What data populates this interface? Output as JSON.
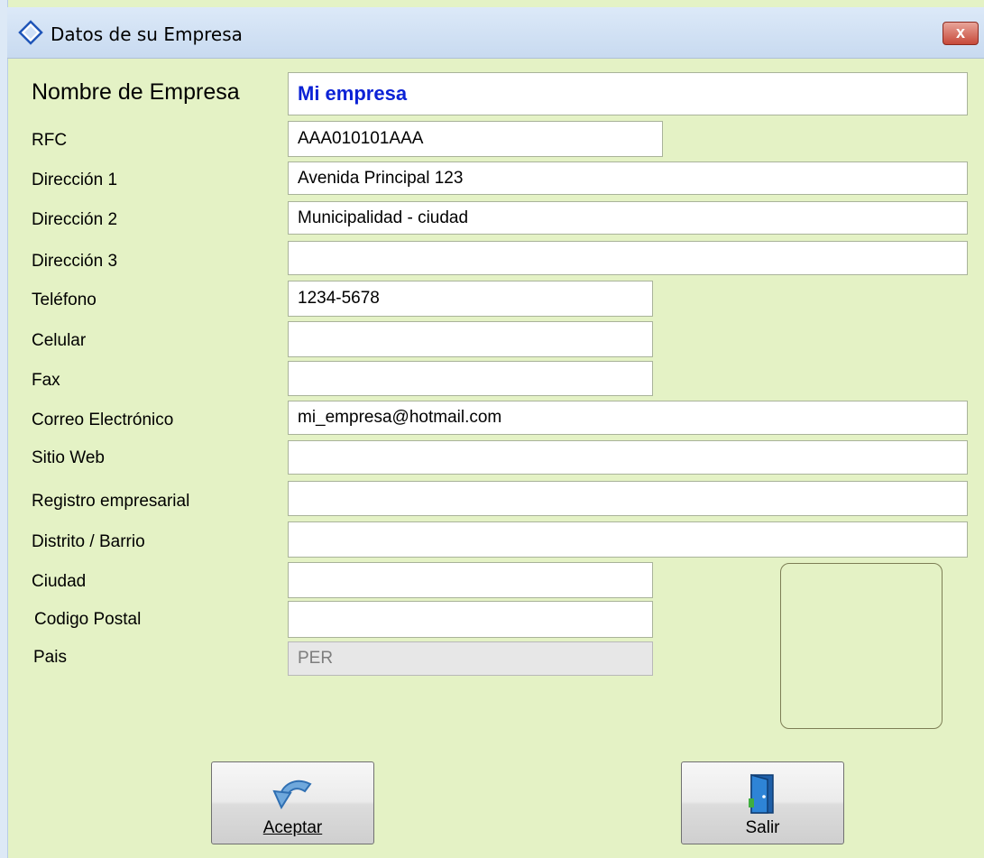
{
  "window": {
    "title": "Datos de su Empresa",
    "close_label": "x"
  },
  "form": {
    "fields": [
      {
        "label": "Nombre de Empresa",
        "value": "Mi empresa"
      },
      {
        "label": "RFC",
        "value": "AAA010101AAA"
      },
      {
        "label": "Dirección 1",
        "value": "Avenida Principal 123"
      },
      {
        "label": "Dirección 2",
        "value": "Municipalidad - ciudad"
      },
      {
        "label": "Dirección 3",
        "value": ""
      },
      {
        "label": "Teléfono",
        "value": "1234-5678"
      },
      {
        "label": "Celular",
        "value": ""
      },
      {
        "label": "Fax",
        "value": ""
      },
      {
        "label": "Correo Electrónico",
        "value": "mi_empresa@hotmail.com"
      },
      {
        "label": "Sitio Web",
        "value": ""
      },
      {
        "label": "Registro empresarial",
        "value": ""
      },
      {
        "label": "Distrito / Barrio",
        "value": ""
      },
      {
        "label": "Ciudad",
        "value": ""
      },
      {
        "label": "Codigo Postal",
        "value": ""
      },
      {
        "label": "Pais",
        "value": "PER"
      }
    ]
  },
  "buttons": {
    "accept_label": "Aceptar",
    "exit_label": "Salir"
  },
  "colors": {
    "background": "#e4f2c5",
    "company_name_text": "#0b22d6"
  },
  "icons": {
    "title": "diamond-icon",
    "accept": "undo-arrow-icon",
    "exit": "door-exit-icon"
  }
}
